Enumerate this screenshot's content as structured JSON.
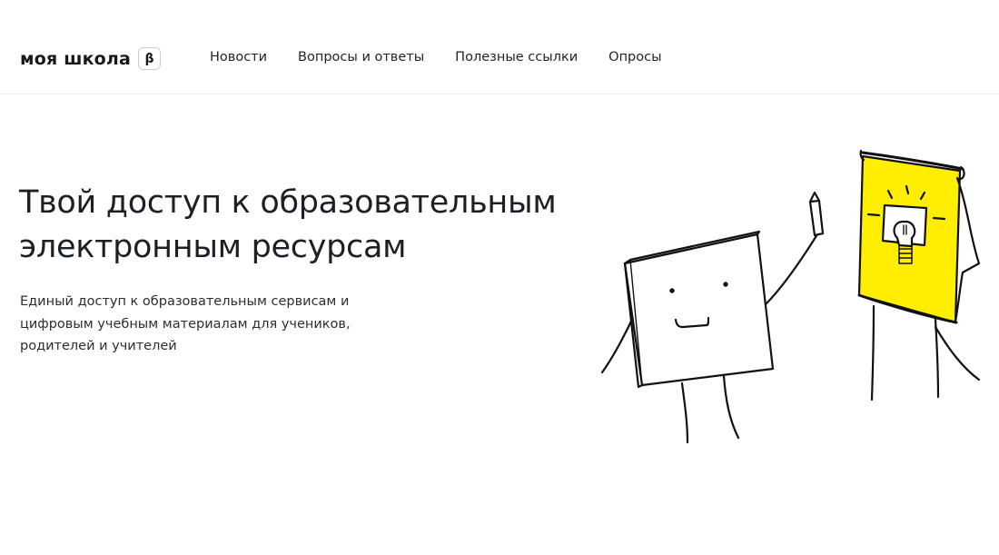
{
  "header": {
    "logo_text": "моя школа",
    "beta_badge": "β",
    "nav": [
      {
        "label": "Новости"
      },
      {
        "label": "Вопросы и ответы"
      },
      {
        "label": "Полезные ссылки"
      },
      {
        "label": "Опросы"
      }
    ]
  },
  "hero": {
    "title_line1": "Твой доступ к образовательным",
    "title_line2": "электронным ресурсам",
    "subtitle_line1": "Единый доступ к образовательным сервисам и",
    "subtitle_line2": "цифровым учебным материалам для учеников,",
    "subtitle_line3": "родителей и учителей"
  },
  "illustration": {
    "flipchart_color": "#ffee00",
    "line_color": "#111111"
  }
}
